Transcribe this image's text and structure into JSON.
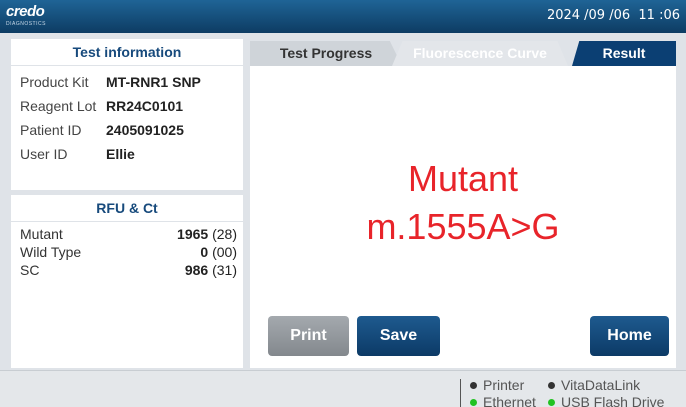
{
  "header": {
    "logo": "credo",
    "logo_sub": "DIAGNOSTICS",
    "datetime": "2024 /09 /06  11 :06"
  },
  "test_info": {
    "title": "Test information",
    "rows": [
      {
        "label": "Product Kit",
        "value": "MT-RNR1 SNP"
      },
      {
        "label": "Reagent Lot",
        "value": "RR24C0101"
      },
      {
        "label": "Patient ID",
        "value": "2405091025"
      },
      {
        "label": "User ID",
        "value": "Ellie"
      }
    ]
  },
  "rfu_ct": {
    "title": "RFU & Ct",
    "rows": [
      {
        "label": "Mutant",
        "rfu": "1965",
        "ct": "(28)"
      },
      {
        "label": "Wild Type",
        "rfu": "0",
        "ct": "(00)"
      },
      {
        "label": "SC",
        "rfu": "986",
        "ct": "(31)"
      }
    ]
  },
  "tabs": {
    "progress": "Test Progress",
    "fluorescence": "Fluorescence Curve",
    "result": "Result",
    "active": "result"
  },
  "result": {
    "type": "Mutant",
    "mutation": "m.1555A>G"
  },
  "buttons": {
    "print": "Print",
    "save": "Save",
    "home": "Home"
  },
  "status": {
    "items": [
      {
        "label": "Printer",
        "color": "#333333"
      },
      {
        "label": "VitaDataLink",
        "color": "#333333"
      },
      {
        "label": "Ethernet",
        "color": "#22c222"
      },
      {
        "label": "USB Flash Drive",
        "color": "#22c222"
      }
    ]
  },
  "colors": {
    "accent": "#0b3f73",
    "result_red": "#e8242a",
    "ok_green": "#22c222"
  }
}
